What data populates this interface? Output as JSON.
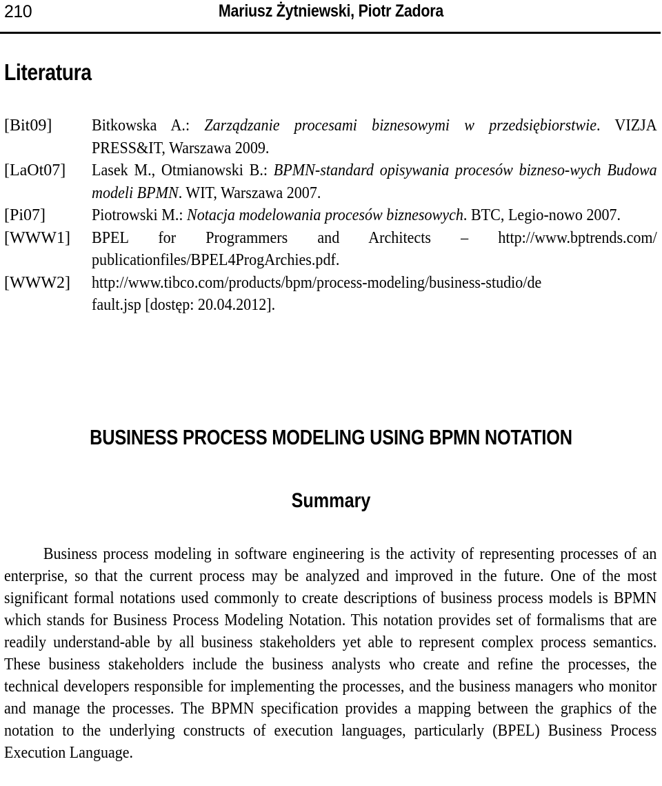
{
  "header": {
    "page_number": "210",
    "authors": "Mariusz Żytniewski, Piotr Zadora"
  },
  "literature": {
    "title": "Literatura",
    "references": [
      {
        "key": "[Bit09]",
        "author": "Bitkowska A.: ",
        "title": "Zarządzanie procesami biznesowymi w przedsiębiorstwie",
        "rest": ". VIZJA PRESS&IT, Warszawa 2009."
      },
      {
        "key": "[LaOt07]",
        "author": "Lasek M., Otmianowski B.: ",
        "title": "BPMN-standard opisywania procesów bizneso-wych Budowa modeli BPMN",
        "rest": ". WIT, Warszawa 2007."
      },
      {
        "key": "[Pi07]",
        "author": "Piotrowski M.: ",
        "title": "Notacja modelowania procesów biznesowych",
        "rest": ". BTC, Legio-nowo 2007."
      },
      {
        "key": "[WWW1]",
        "text_line1": "BPEL for Programmers and Architects – http://www.bptrends.com/",
        "text_line2": "publicationfiles/BPEL4ProgArchies.pdf."
      },
      {
        "key": "[WWW2]",
        "text_line1": "http://www.tibco.com/products/bpm/process-modeling/business-studio/de",
        "text_line2": "fault.jsp [dostęp: 20.04.2012]."
      }
    ]
  },
  "paper": {
    "title": "BUSINESS PROCESS MODELING USING BPMN NOTATION",
    "summary_heading": "Summary",
    "summary_text": "Business process modeling in software engineering is the activity of representing processes of an enterprise, so that the current process may be analyzed and improved in the future. One of the most significant formal notations used commonly to create descriptions of business process models is BPMN which stands for Business Process Modeling Notation. This notation provides set of formalisms that are readily understand-able by all business stakeholders yet able to represent complex process semantics. These business stakeholders include the business analysts who create and refine the processes, the technical developers responsible for implementing the processes, and the business managers who monitor and manage the processes. The BPMN specification provides a mapping between the graphics of the notation to the underlying constructs of execution languages, particularly (BPEL) Business Process Execution Language."
  }
}
